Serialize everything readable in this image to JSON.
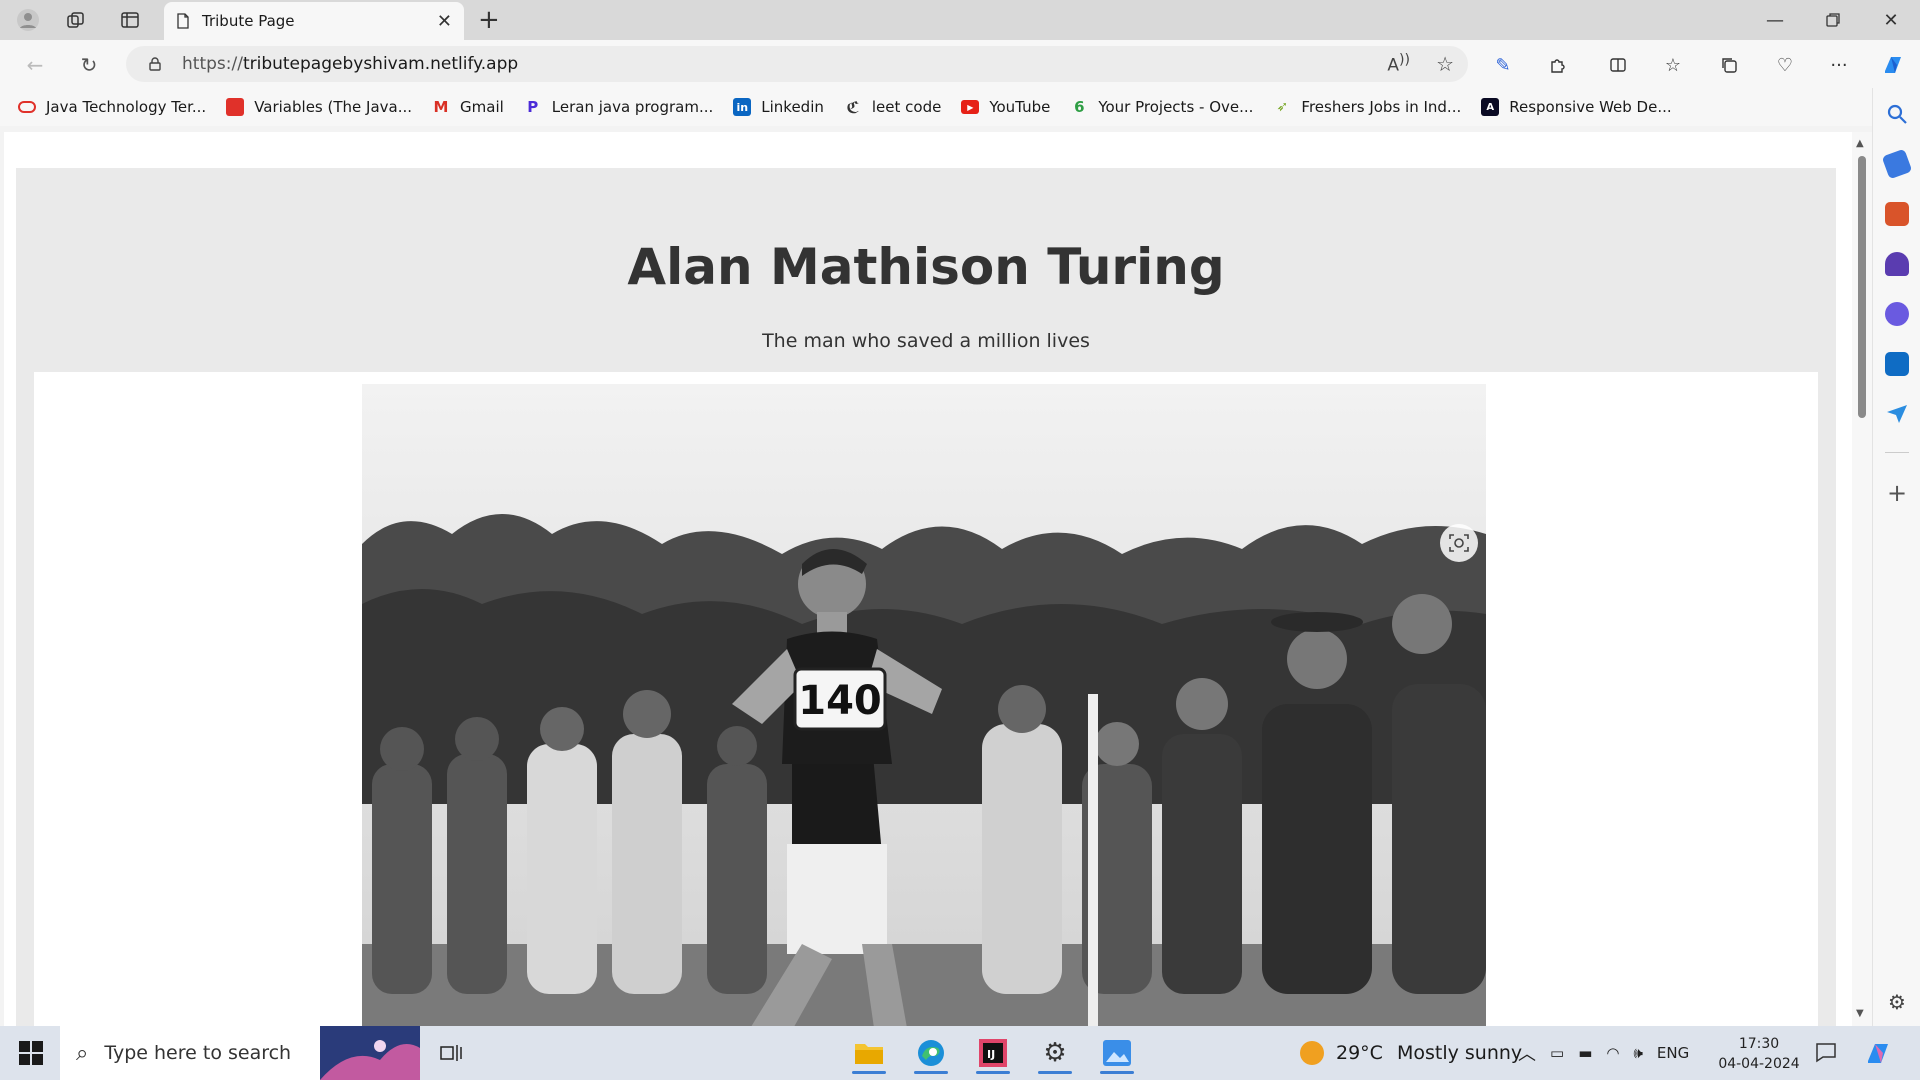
{
  "browser": {
    "tab_title": "Tribute Page",
    "url": "https://tributepagebyshivam.netlify.app",
    "url_host": "tributepagebyshivam.netlify.app",
    "url_scheme": "https://"
  },
  "bookmarks": [
    {
      "label": "Java Technology Ter...",
      "icon": "oracle-icon",
      "color": "#e0312a"
    },
    {
      "label": "Variables (The Java...",
      "icon": "oracle-icon",
      "color": "#e0312a"
    },
    {
      "label": "Gmail",
      "icon": "gmail-icon",
      "color": "#d93025"
    },
    {
      "label": "Leran java program...",
      "icon": "p-icon",
      "color": "#4b2bd8"
    },
    {
      "label": "Linkedin",
      "icon": "linkedin-icon",
      "color": "#0a66c2"
    },
    {
      "label": "leet code",
      "icon": "leetcode-icon",
      "color": "#333333"
    },
    {
      "label": "YouTube",
      "icon": "youtube-icon",
      "color": "#e62117"
    },
    {
      "label": "Your Projects - Ove...",
      "icon": "project-icon",
      "color": "#2e9e44"
    },
    {
      "label": "Freshers Jobs in Ind...",
      "icon": "jobs-icon",
      "color": "#7aa82a"
    },
    {
      "label": "Responsive Web De...",
      "icon": "freecodecamp-icon",
      "color": "#0a0a23"
    }
  ],
  "page": {
    "heading": "Alan Mathison Turing",
    "subtitle": "The man who saved a million lives",
    "photo_bib_number": "140"
  },
  "taskbar": {
    "search_placeholder": "Type here to search",
    "temperature": "29°C",
    "condition": "Mostly sunny",
    "language": "ENG",
    "time": "17:30",
    "date": "04-04-2024"
  }
}
